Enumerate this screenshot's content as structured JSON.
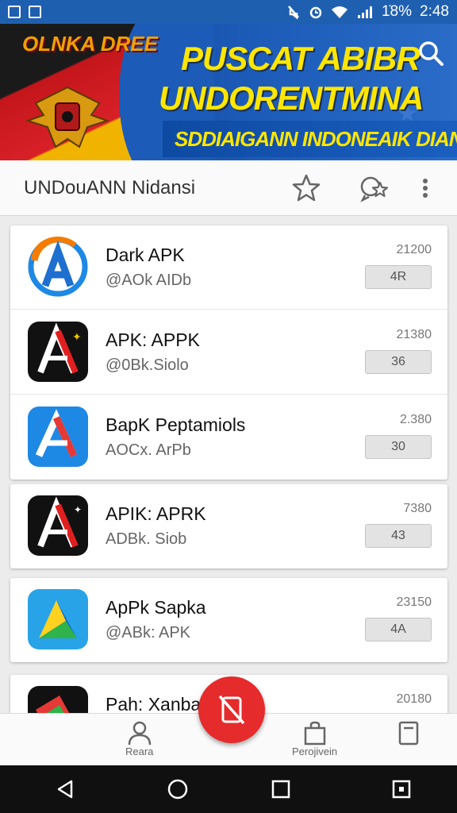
{
  "status_bar": {
    "battery": "1̇8%",
    "time": "2:48"
  },
  "banner": {
    "emblem_text": "OLNKA DREE",
    "title_line1": "PUSCAT ABIBR",
    "title_line2": "UNDORENTMINA",
    "subtitle": "SDDIAIGANN INDONEAIK DIANE"
  },
  "toolbar": {
    "title": "UNDouANN Nidansi"
  },
  "apps": [
    {
      "name": "Dark APK",
      "sub": "@AOk AIDb",
      "size": "21200",
      "btn": "4R",
      "logo": "blue-a-ring"
    },
    {
      "name": "APK: APPK",
      "sub": "@0Bk.Siolo",
      "size": "21380",
      "btn": "36",
      "logo": "dark-red-a"
    },
    {
      "name": "BapK Peptamiols",
      "sub": "AOCx. ArPb",
      "size": "2.380",
      "btn": "30",
      "logo": "blue-red-a"
    },
    {
      "name": "APIK: APRK",
      "sub": "ADBk. Siob",
      "size": "7380",
      "btn": "43",
      "logo": "dark-red-a"
    },
    {
      "name": "ApPk Sapka",
      "sub": "@ABk: APK",
      "size": "23150",
      "btn": "4A",
      "logo": "green-yellow-a"
    },
    {
      "name": "Pah: Xanbah",
      "sub": "",
      "size": "20180",
      "btn": "",
      "logo": "flag-a"
    }
  ],
  "bottom_nav": {
    "left_label": "Reara",
    "right_label": "Perojivein"
  },
  "colors": {
    "accent_blue": "#1f5fb0",
    "fab_red": "#e52b2b",
    "banner_yellow": "#ffe600"
  }
}
